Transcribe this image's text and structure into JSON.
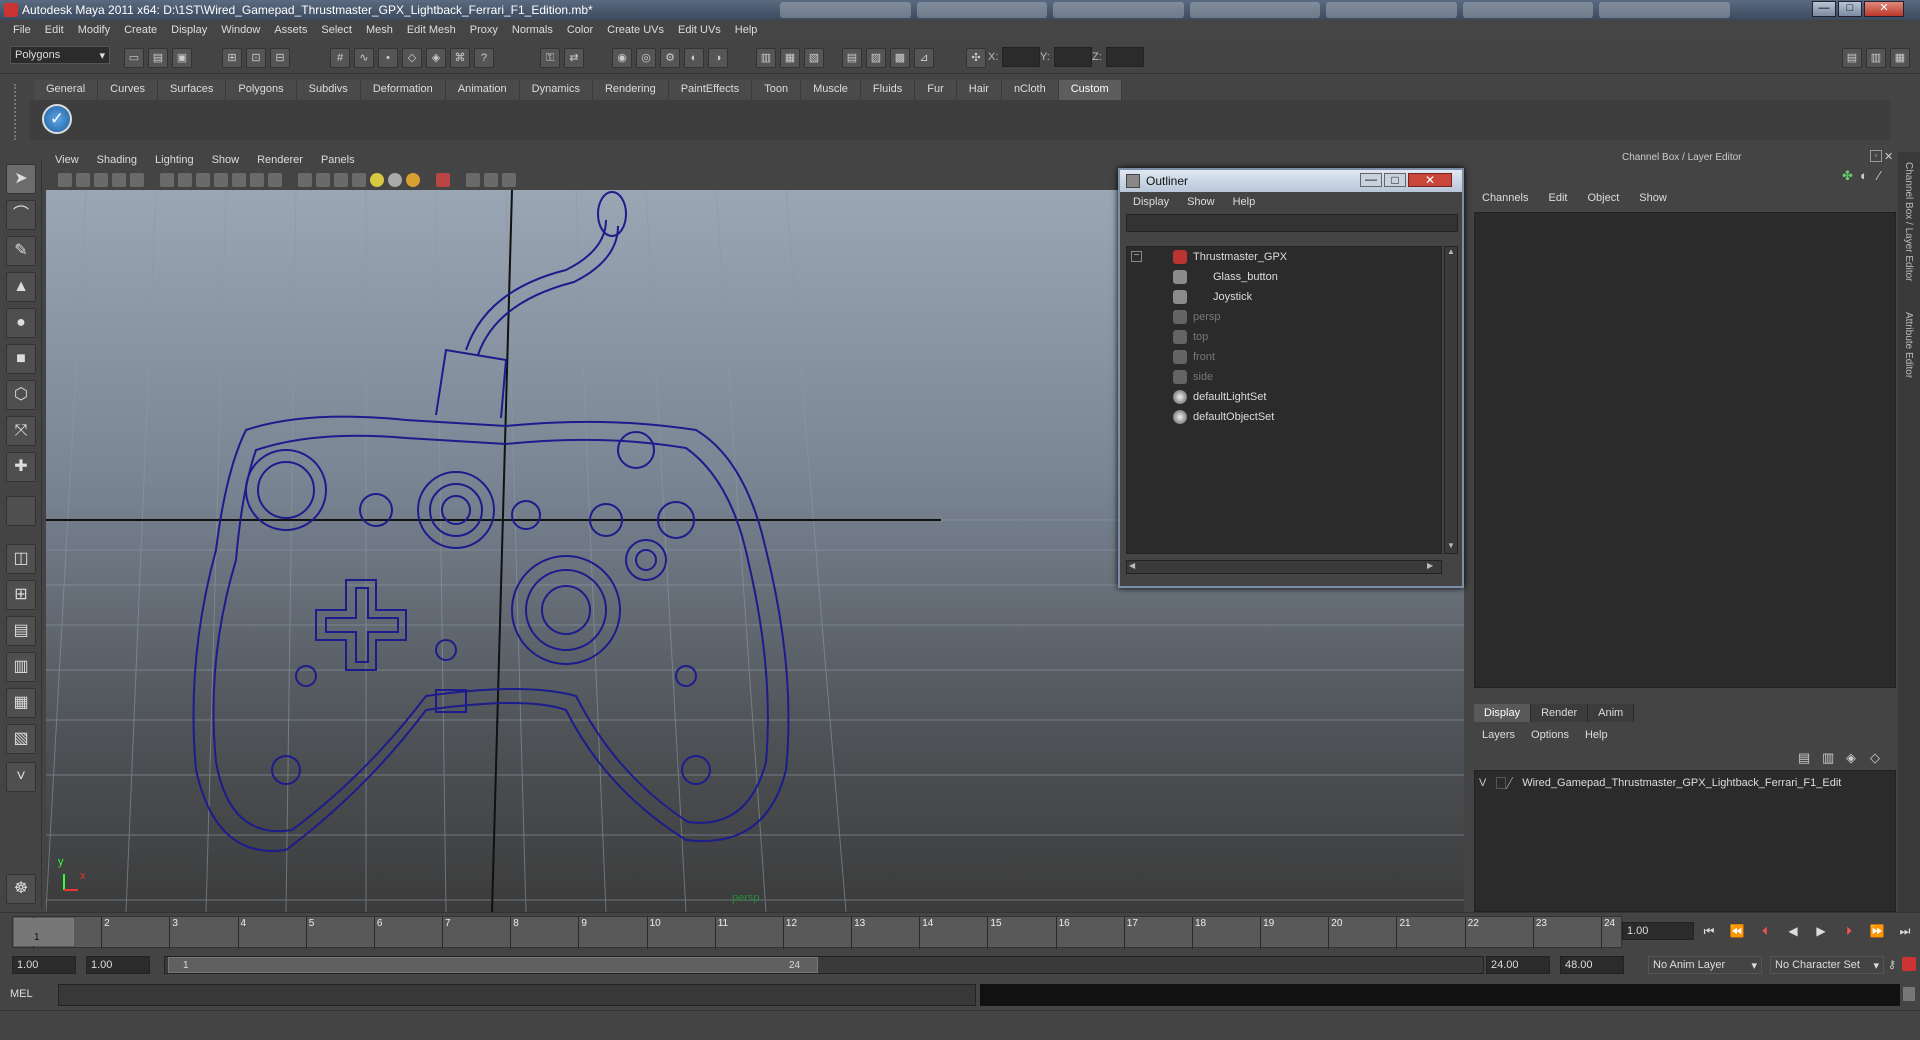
{
  "window": {
    "title": "Autodesk Maya 2011 x64: D:\\1ST\\Wired_Gamepad_Thrustmaster_GPX_Lightback_Ferrari_F1_Edition.mb*",
    "min_label": "—",
    "max_label": "□",
    "close_label": "✕"
  },
  "menus": [
    "File",
    "Edit",
    "Modify",
    "Create",
    "Display",
    "Window",
    "Assets",
    "Select",
    "Mesh",
    "Edit Mesh",
    "Proxy",
    "Normals",
    "Color",
    "Create UVs",
    "Edit UVs",
    "Help"
  ],
  "status_line": {
    "mode": "Polygons",
    "x_label": "X:",
    "y_label": "Y:",
    "z_label": "Z:"
  },
  "shelf": {
    "tabs": [
      "General",
      "Curves",
      "Surfaces",
      "Polygons",
      "Subdivs",
      "Deformation",
      "Animation",
      "Dynamics",
      "Rendering",
      "PaintEffects",
      "Toon",
      "Muscle",
      "Fluids",
      "Fur",
      "Hair",
      "nCloth",
      "Custom"
    ],
    "active_tab": "Custom",
    "button_glyph": "✓"
  },
  "panel_menu": [
    "View",
    "Shading",
    "Lighting",
    "Show",
    "Renderer",
    "Panels"
  ],
  "viewport": {
    "camera_label": "persp",
    "axis_x": "x",
    "axis_y": "y",
    "wire_color": "#1c1c8c"
  },
  "outliner": {
    "title": "Outliner",
    "menu": [
      "Display",
      "Show",
      "Help"
    ],
    "items": [
      {
        "label": "Thrustmaster_GPX",
        "dim": false
      },
      {
        "label": "Glass_button",
        "dim": false
      },
      {
        "label": "Joystick",
        "dim": false
      },
      {
        "label": "persp",
        "dim": true
      },
      {
        "label": "top",
        "dim": true
      },
      {
        "label": "front",
        "dim": true
      },
      {
        "label": "side",
        "dim": true
      },
      {
        "label": "defaultLightSet",
        "dim": false
      },
      {
        "label": "defaultObjectSet",
        "dim": false
      }
    ]
  },
  "channel_box": {
    "title": "Channel Box / Layer Editor",
    "menu": [
      "Channels",
      "Edit",
      "Object",
      "Show"
    ],
    "side_tabs": [
      "Channel Box / Layer Editor",
      "Attribute Editor"
    ]
  },
  "layer_editor": {
    "tabs": [
      "Display",
      "Render",
      "Anim"
    ],
    "active_tab": "Display",
    "menu": [
      "Layers",
      "Options",
      "Help"
    ],
    "layer_row": "Wired_Gamepad_Thrustmaster_GPX_Lightback_Ferrari_F1_Edit",
    "visibility": "V"
  },
  "timeline": {
    "ticks": [
      "1",
      "2",
      "3",
      "4",
      "5",
      "6",
      "7",
      "8",
      "9",
      "10",
      "11",
      "12",
      "13",
      "14",
      "15",
      "16",
      "17",
      "18",
      "19",
      "20",
      "21",
      "22",
      "23",
      "24"
    ],
    "current_frame": "1",
    "current_frame_field": "1.00"
  },
  "range": {
    "start": "1.00",
    "playback_start": "1.00",
    "handle_start": "1",
    "handle_end": "24",
    "playback_end": "24.00",
    "end": "48.00",
    "anim_layer": "No Anim Layer",
    "character_set": "No Character Set"
  },
  "command_line": {
    "label": "MEL"
  }
}
